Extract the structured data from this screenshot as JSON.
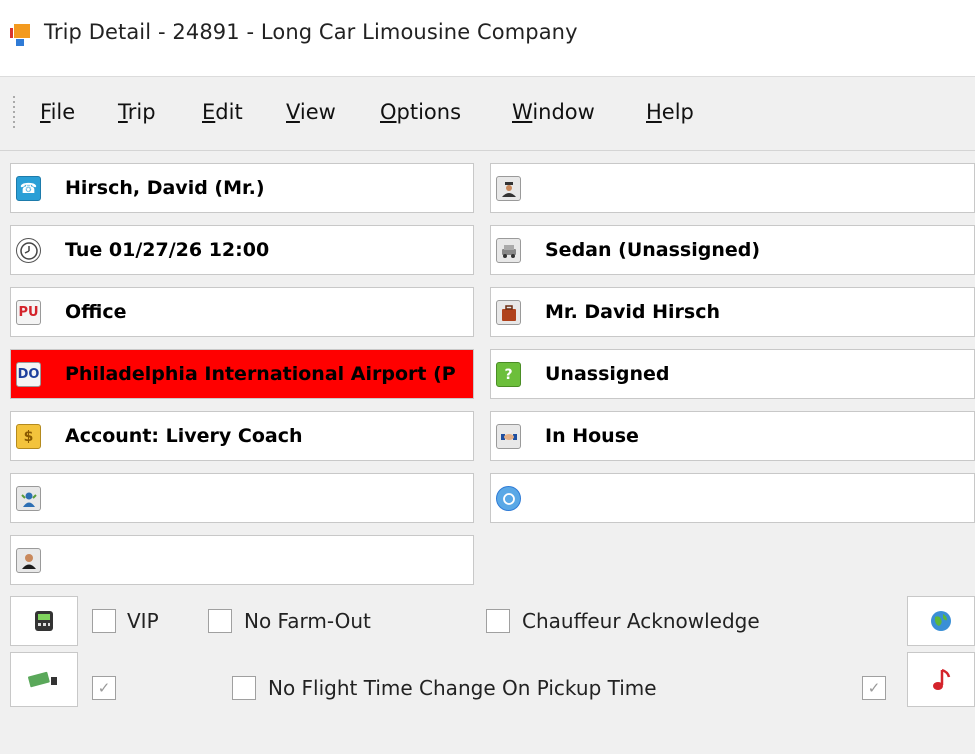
{
  "window": {
    "title": "Trip Detail - 24891 - Long Car Limousine Company"
  },
  "menu": {
    "file": {
      "u": "F",
      "rest": "ile"
    },
    "trip": {
      "u": "T",
      "rest": "rip"
    },
    "edit": {
      "u": "E",
      "rest": "dit"
    },
    "view": {
      "u": "V",
      "rest": "iew"
    },
    "options": {
      "u": "O",
      "rest": "ptions"
    },
    "window": {
      "u": "W",
      "rest": "indow"
    },
    "help": {
      "u": "H",
      "rest": "elp"
    }
  },
  "left_fields": {
    "passenger": "Hirsch, David (Mr.)",
    "datetime": "Tue 01/27/26 12:00",
    "pickup_badge": "PU",
    "pickup": "Office",
    "dropoff_badge": "DO",
    "dropoff": "Philadelphia International Airport (P",
    "billing": "Account: Livery Coach",
    "agent": "",
    "contact": ""
  },
  "right_fields": {
    "chauffeur": "",
    "vehicle": "Sedan (Unassigned)",
    "luggage_passenger": "Mr. David Hirsch",
    "status": "Unassigned",
    "affiliate": "In House",
    "recurring": ""
  },
  "options": {
    "vip": "VIP",
    "no_farm_out": "No Farm-Out",
    "chauffeur_ack": "Chauffeur Acknowledge",
    "no_flight_time": "No Flight Time Change On Pickup Time",
    "check_mark": "✓"
  },
  "colors": {
    "dropoff_bg": "#ff0000",
    "accent": "#2f7bd6"
  }
}
